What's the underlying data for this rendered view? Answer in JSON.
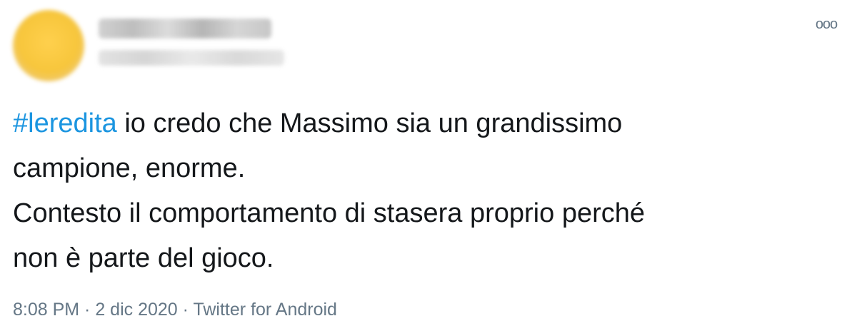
{
  "tweet": {
    "hashtag": "#leredita",
    "body_line1": " io credo che Massimo sia un grandissimo",
    "body_rest": "campione, enorme.\nContesto il comportamento di stasera proprio perché\nnon è parte del gioco.",
    "time": "8:08 PM",
    "separator": " · ",
    "date": "2 dic 2020",
    "source": "Twitter for Android",
    "more_icon": "ooo"
  },
  "colors": {
    "hashtag": "#1b95e0",
    "text": "#14171a",
    "meta": "#657786"
  },
  "icons": {
    "more": "more-options-icon",
    "avatar": "avatar-blurred"
  }
}
